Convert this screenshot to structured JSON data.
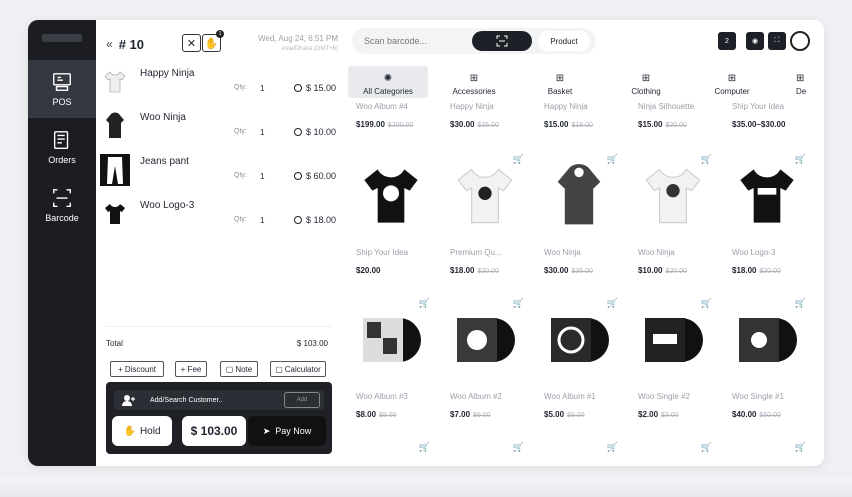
{
  "nav": {
    "items": [
      {
        "label": "POS",
        "icon": "pos-icon"
      },
      {
        "label": "Orders",
        "icon": "orders-icon"
      },
      {
        "label": "Barcode",
        "icon": "barcode-icon"
      }
    ]
  },
  "cart": {
    "back": "«",
    "order_no": "# 10",
    "date": "Wed, Aug 24, 6:51 PM",
    "subdate": "Asia/Dhaka (GMT+6)",
    "notif_badge": "1",
    "qty_label": "Qty:",
    "items": [
      {
        "name": "Happy Ninja",
        "qty": "1",
        "price": "$ 15.00"
      },
      {
        "name": "Woo Ninja",
        "qty": "1",
        "price": "$ 10.00"
      },
      {
        "name": "Jeans pant",
        "qty": "1",
        "price": "$ 60.00"
      },
      {
        "name": "Woo Logo-3",
        "qty": "1",
        "price": "$ 18.00"
      }
    ],
    "total_label": "Total",
    "total_value": "$ 103.00",
    "buttons": {
      "discount": "+ Discount",
      "fee": "+ Fee",
      "note": "Note",
      "calculator": "Calculator"
    },
    "customer_placeholder": "Add/Search Customer..",
    "customer_add": "Add",
    "hold": "Hold",
    "amount": "$ 103.00",
    "pay_now": "Pay Now"
  },
  "top": {
    "search_placeholder": "Scan barcode...",
    "product_label": "Product",
    "counter": "2"
  },
  "categories": [
    "All Categories",
    "Accessories",
    "Basket",
    "Clothing",
    "Computer",
    "De"
  ],
  "products_top": [
    {
      "name": "Woo Album #4",
      "price": "$199.00",
      "old": "$200.00"
    },
    {
      "name": "Happy Ninja",
      "price": "$30.00",
      "old": "$35.00"
    },
    {
      "name": "Happy Ninja",
      "price": "$15.00",
      "old": "$18.00"
    },
    {
      "name": "Ninja Silhouette",
      "price": "$15.00",
      "old": "$20.00"
    },
    {
      "name": "Ship Your Idea",
      "price": "$35.00–$30.00",
      "old": ""
    }
  ],
  "products_row1": [
    {
      "name": "Ship Your Idea",
      "price": "$20.00",
      "old": ""
    },
    {
      "name": "Premium Qu...",
      "price": "$18.00",
      "old": "$20.00"
    },
    {
      "name": "Woo Ninja",
      "price": "$30.00",
      "old": "$35.00"
    },
    {
      "name": "Woo Ninja",
      "price": "$10.00",
      "old": "$20.00"
    },
    {
      "name": "Woo Logo-3",
      "price": "$18.00",
      "old": "$20.00"
    }
  ],
  "products_row2": [
    {
      "name": "Woo Album #3",
      "price": "$8.00",
      "old": "$9.00"
    },
    {
      "name": "Woo Album #2",
      "price": "$7.00",
      "old": "$9.00"
    },
    {
      "name": "Woo Album #1",
      "price": "$5.00",
      "old": "$9.00"
    },
    {
      "name": "Woo Single #2",
      "price": "$2.00",
      "old": "$3.00"
    },
    {
      "name": "Woo Single #1",
      "price": "$40.00",
      "old": "$50.00"
    }
  ]
}
